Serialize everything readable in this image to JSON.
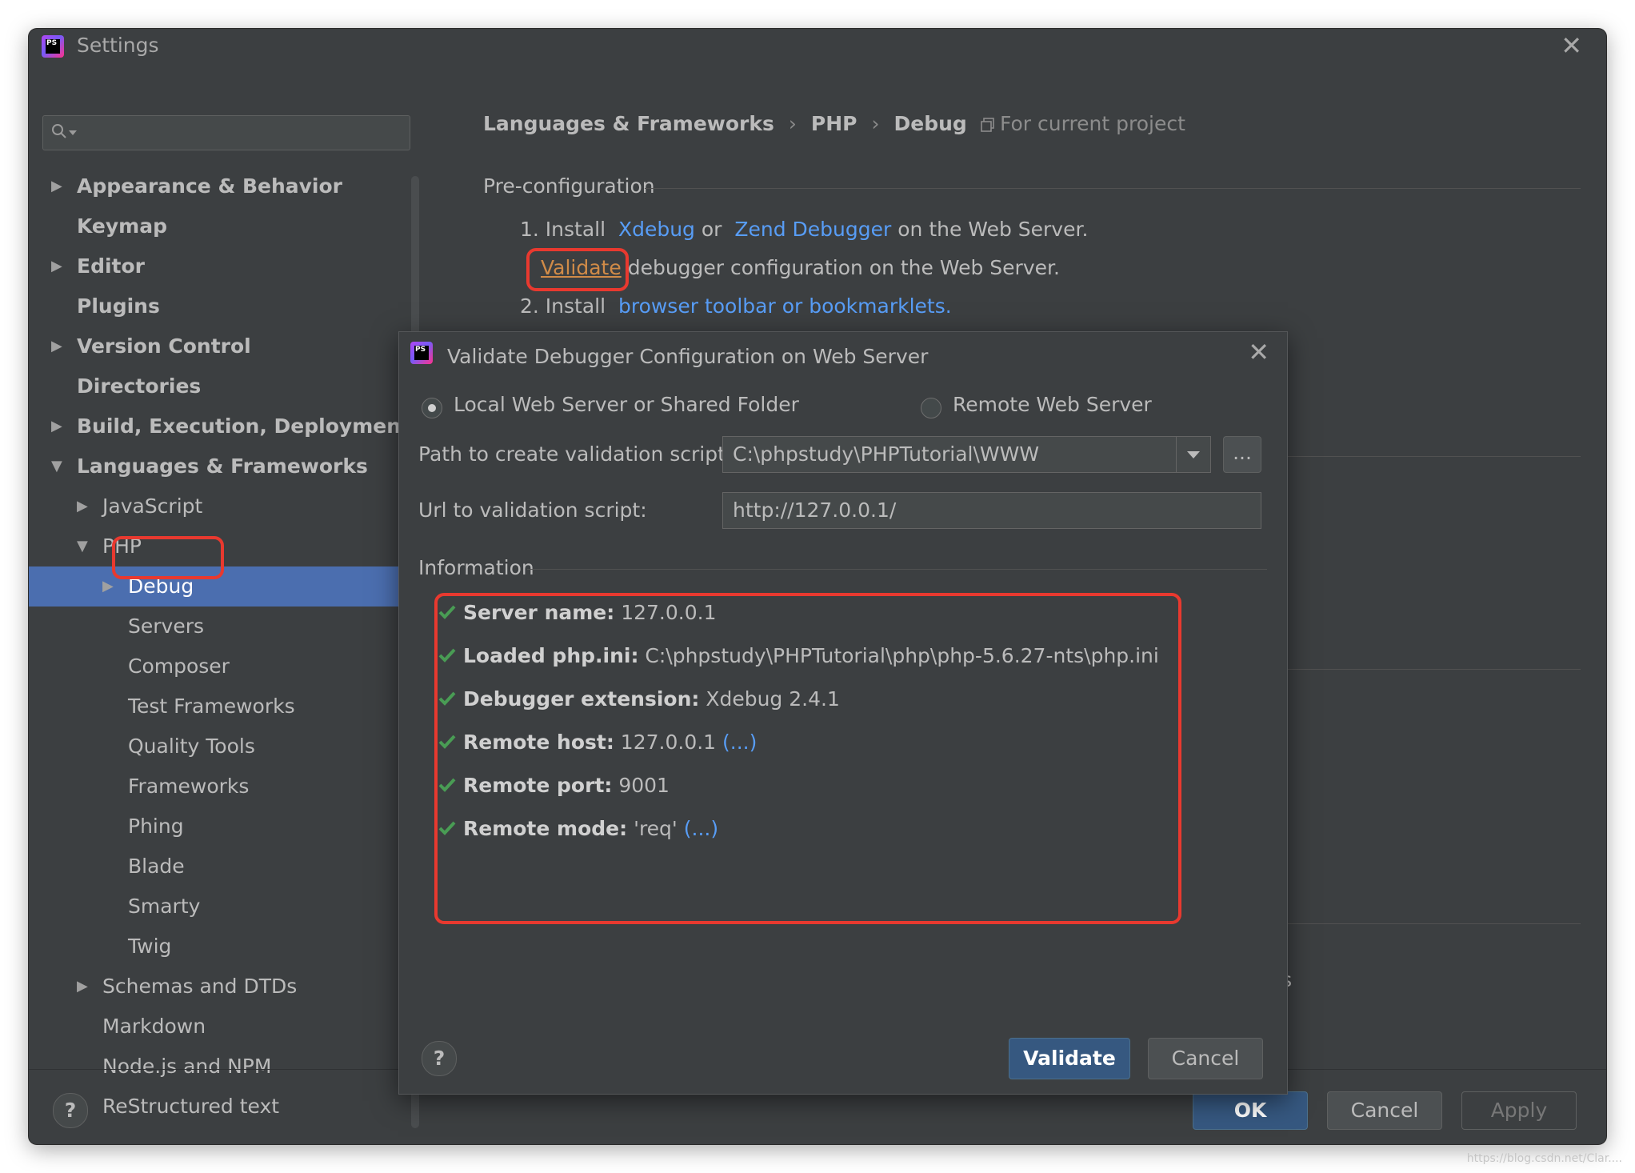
{
  "window": {
    "title": "Settings"
  },
  "search": {
    "placeholder": ""
  },
  "sidebar": {
    "items": [
      {
        "label": "Appearance & Behavior",
        "arrow": "right",
        "bold": true
      },
      {
        "label": "Keymap",
        "arrow": "",
        "bold": true
      },
      {
        "label": "Editor",
        "arrow": "right",
        "bold": true
      },
      {
        "label": "Plugins",
        "arrow": "",
        "bold": true
      },
      {
        "label": "Version Control",
        "arrow": "right",
        "bold": true
      },
      {
        "label": "Directories",
        "arrow": "",
        "bold": true
      },
      {
        "label": "Build, Execution, Deployment",
        "arrow": "right",
        "bold": true
      },
      {
        "label": "Languages & Frameworks",
        "arrow": "down",
        "bold": true
      },
      {
        "label": "JavaScript",
        "arrow": "right",
        "bold": false
      },
      {
        "label": "PHP",
        "arrow": "down",
        "bold": false
      },
      {
        "label": "Debug",
        "arrow": "right",
        "bold": false,
        "selected": true
      },
      {
        "label": "Servers",
        "arrow": "",
        "bold": false
      },
      {
        "label": "Composer",
        "arrow": "",
        "bold": false
      },
      {
        "label": "Test Frameworks",
        "arrow": "",
        "bold": false
      },
      {
        "label": "Quality Tools",
        "arrow": "",
        "bold": false
      },
      {
        "label": "Frameworks",
        "arrow": "",
        "bold": false
      },
      {
        "label": "Phing",
        "arrow": "",
        "bold": false
      },
      {
        "label": "Blade",
        "arrow": "",
        "bold": false
      },
      {
        "label": "Smarty",
        "arrow": "",
        "bold": false
      },
      {
        "label": "Twig",
        "arrow": "",
        "bold": false
      },
      {
        "label": "Schemas and DTDs",
        "arrow": "right",
        "bold": false
      },
      {
        "label": "Markdown",
        "arrow": "",
        "bold": false
      },
      {
        "label": "Node.js and NPM",
        "arrow": "",
        "bold": false
      },
      {
        "label": "ReStructured text",
        "arrow": "",
        "bold": false
      }
    ]
  },
  "breadcrumb": [
    "Languages & Frameworks",
    "PHP",
    "Debug"
  ],
  "scope_label": "For current project",
  "preconfig": {
    "title": "Pre-configuration",
    "step1_prefix": "1. Install",
    "step1_link1": "Xdebug",
    "step1_or": "or",
    "step1_link2": "Zend Debugger",
    "step1_suffix": "on the Web Server.",
    "validate_link": "Validate",
    "validate_suffix": "debugger configuration on the Web Server.",
    "step2_prefix": "2. Install",
    "step2_link": "browser toolbar or bookmarklets."
  },
  "background_fragment": "ons",
  "dialog": {
    "title": "Validate Debugger Configuration on Web Server",
    "radio_local": "Local Web Server or Shared Folder",
    "radio_remote": "Remote Web Server",
    "path_label": "Path to create validation script:",
    "path_value": "C:\\phpstudy\\PHPTutorial\\WWW",
    "browse_label": "...",
    "url_label": "Url to validation script:",
    "url_value": "http://127.0.0.1/",
    "info_title": "Information",
    "info": [
      {
        "key": "Server name:",
        "value": "127.0.0.1",
        "link": ""
      },
      {
        "key": "Loaded php.ini:",
        "value": "C:\\phpstudy\\PHPTutorial\\php\\php-5.6.27-nts\\php.ini",
        "link": ""
      },
      {
        "key": "Debugger extension:",
        "value": "Xdebug 2.4.1",
        "link": ""
      },
      {
        "key": "Remote host:",
        "value": "127.0.0.1",
        "link": "(...)"
      },
      {
        "key": "Remote port:",
        "value": "9001",
        "link": ""
      },
      {
        "key": "Remote mode:",
        "value": "'req'",
        "link": "(...)"
      }
    ],
    "help_label": "?",
    "validate_button": "Validate",
    "cancel_button": "Cancel"
  },
  "footer": {
    "help_label": "?",
    "ok_button": "OK",
    "cancel_button": "Cancel",
    "apply_button": "Apply"
  },
  "watermark": "https://blog.csdn.net/Clar....",
  "colors": {
    "background": "#3c3f41",
    "selection": "#4b6eaf",
    "link": "#589df6",
    "highlight": "#e8392f",
    "check": "#499c54",
    "primary_button": "#365880"
  }
}
